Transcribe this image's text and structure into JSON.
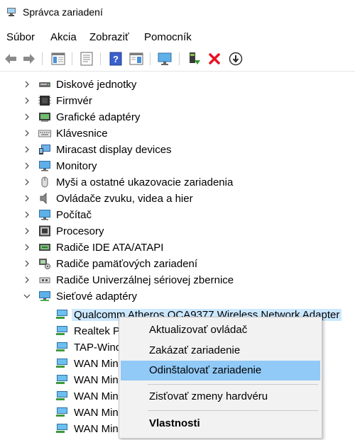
{
  "window": {
    "title": "Správca zariadení"
  },
  "menu": [
    "Súbor",
    "Akcia",
    "Zobraziť",
    "Pomocník"
  ],
  "toolbar": [
    "back-icon",
    "forward-icon",
    "show-hide-tree-icon",
    "properties-icon",
    "help-icon",
    "action-pane-icon",
    "monitor-scan-icon",
    "update-driver-icon",
    "uninstall-icon",
    "disable-device-icon"
  ],
  "tree": [
    {
      "label": "Diskové jednotky",
      "icon": "disk-icon"
    },
    {
      "label": "Firmvér",
      "icon": "chip-icon"
    },
    {
      "label": "Grafické adaptéry",
      "icon": "display-adapter-icon"
    },
    {
      "label": "Klávesnice",
      "icon": "keyboard-icon"
    },
    {
      "label": "Miracast display devices",
      "icon": "miracast-icon"
    },
    {
      "label": "Monitory",
      "icon": "monitor-icon"
    },
    {
      "label": "Myši a ostatné ukazovacie zariadenia",
      "icon": "mouse-icon"
    },
    {
      "label": "Ovládače zvuku, videa a hier",
      "icon": "speaker-icon"
    },
    {
      "label": "Počítač",
      "icon": "computer-icon"
    },
    {
      "label": "Procesory",
      "icon": "processor-icon"
    },
    {
      "label": "Radiče IDE ATA/ATAPI",
      "icon": "ide-icon"
    },
    {
      "label": "Radiče pamäťových zariadení",
      "icon": "storage-controller-icon"
    },
    {
      "label": "Radiče Univerzálnej sériovej zbernice",
      "icon": "usb-icon"
    },
    {
      "label": "Sieťové adaptéry",
      "icon": "network-icon",
      "expanded": true
    }
  ],
  "network_children": [
    "Qualcomm Atheros QCA9377 Wireless Network Adapter",
    "Realtek P",
    "TAP-Wind",
    "WAN Min",
    "WAN Min",
    "WAN Min",
    "WAN Min",
    "WAN Min"
  ],
  "context_menu": {
    "items": [
      "Aktualizovať ovládač",
      "Zakázať zariadenie",
      "Odinštalovať zariadenie",
      "Zisťovať zmeny hardvéru",
      "Vlastnosti"
    ],
    "highlighted": "Odinštalovať zariadenie"
  },
  "colors": {
    "selection": "#cce8ff",
    "menu_highlight": "#91c9f7",
    "uninstall_red": "#e81123",
    "update_green": "#2e9a2e"
  }
}
